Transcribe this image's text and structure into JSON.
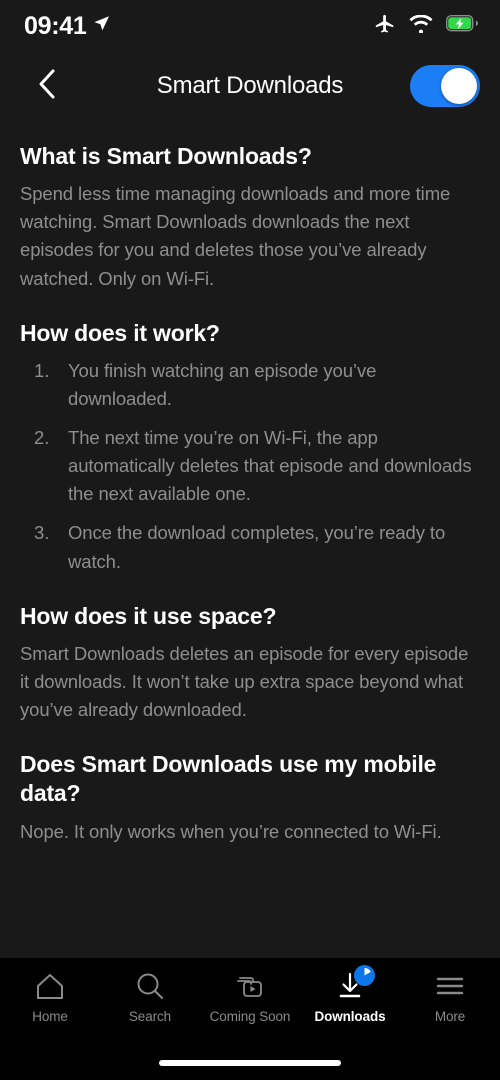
{
  "status_bar": {
    "time": "09:41",
    "location_icon": "location-arrow-icon",
    "airplane_icon": "airplane-mode-icon",
    "wifi_icon": "wifi-icon",
    "battery_icon": "battery-charging-icon"
  },
  "header": {
    "back_icon": "chevron-left-icon",
    "title": "Smart Downloads",
    "toggle_state": "on",
    "toggle_color": "#1b7ef5"
  },
  "content": {
    "sections": [
      {
        "title": "What is Smart Downloads?",
        "body": "Spend less time managing downloads and more time watching. Smart Downloads downloads the next episodes for you and deletes those you’ve already watched. Only on Wi-Fi."
      },
      {
        "title": "How does it work?",
        "steps": [
          {
            "num": "1.",
            "text": "You finish watching an episode you’ve downloaded."
          },
          {
            "num": "2.",
            "text": "The next time you’re on Wi-Fi, the app automatically deletes that episode and downloads the next available one."
          },
          {
            "num": "3.",
            "text": "Once the download completes, you’re ready to watch."
          }
        ]
      },
      {
        "title": "How does it use space?",
        "body": "Smart Downloads deletes an episode for every episode it downloads. It won’t take up extra space beyond what you’ve already downloaded."
      },
      {
        "title": "Does Smart Downloads use my mobile data?",
        "body": "Nope. It only works when you’re connected to Wi-Fi."
      }
    ]
  },
  "tabbar": {
    "active": "Downloads",
    "badge_color": "#0b77ea",
    "items": [
      {
        "label": "Home",
        "icon": "home-icon"
      },
      {
        "label": "Search",
        "icon": "search-icon"
      },
      {
        "label": "Coming Soon",
        "icon": "coming-soon-icon"
      },
      {
        "label": "Downloads",
        "icon": "download-icon"
      },
      {
        "label": "More",
        "icon": "hamburger-menu-icon"
      }
    ]
  }
}
